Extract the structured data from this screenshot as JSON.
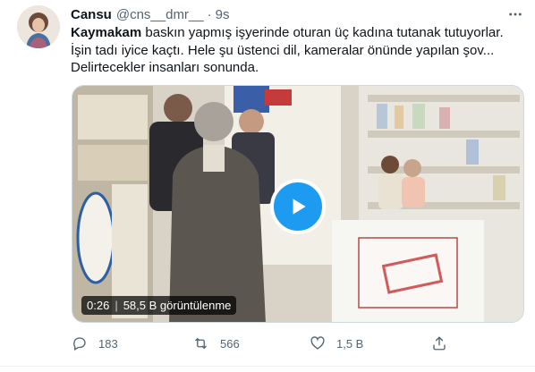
{
  "tweet": {
    "author_name": "Cansu",
    "author_handle": "@cns__dmr__",
    "separator": "·",
    "time": "9s",
    "text": {
      "bold_word": "Kaymakam",
      "line1_rest": " baskın yapmış işyerinde oturan üç kadına tutanak tutuyorlar.",
      "line2": "İşin tadı iyice kaçtı. Hele şu üstenci dil, kameralar önünde yapılan şov...",
      "line3": "Delirtecekler insanları sonunda."
    },
    "video": {
      "duration": "0:26",
      "views": "58,5 B görüntülenme",
      "play_icon": "play-icon"
    },
    "actions": {
      "reply_count": "183",
      "retweet_count": "566",
      "like_count": "1,5 B",
      "icons": [
        "reply-icon",
        "retweet-icon",
        "like-icon",
        "share-icon"
      ]
    },
    "colors": {
      "accent": "#1d9bf0",
      "secondary_text": "#536471",
      "primary_text": "#0f1419"
    }
  }
}
